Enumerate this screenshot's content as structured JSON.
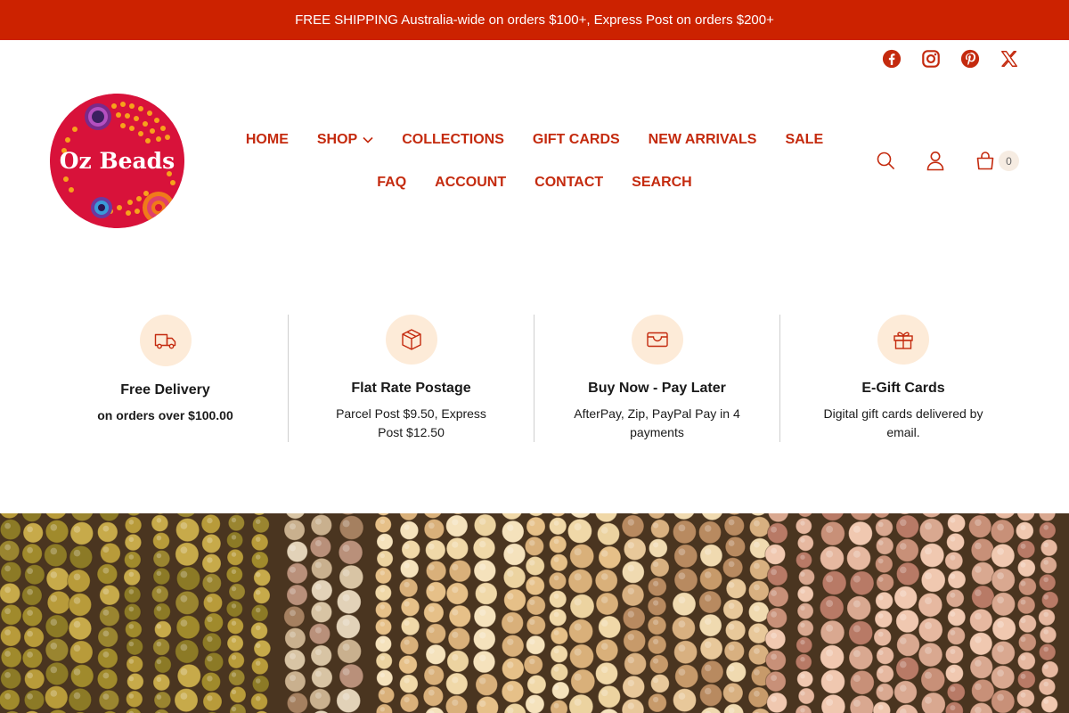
{
  "announcement": {
    "text": "FREE SHIPPING Australia-wide on orders $100+, Express Post on orders $200+"
  },
  "social": {
    "items": [
      {
        "icon": "facebook-icon"
      },
      {
        "icon": "instagram-icon"
      },
      {
        "icon": "pinterest-icon"
      },
      {
        "icon": "x-icon"
      }
    ]
  },
  "logo": {
    "text": "Oz Beads"
  },
  "nav": {
    "row1": [
      {
        "label": "HOME"
      },
      {
        "label": "SHOP"
      },
      {
        "label": "COLLECTIONS"
      },
      {
        "label": "GIFT CARDS"
      },
      {
        "label": "NEW ARRIVALS"
      },
      {
        "label": "SALE"
      }
    ],
    "row2": [
      {
        "label": "FAQ"
      },
      {
        "label": "ACCOUNT"
      },
      {
        "label": "CONTACT"
      },
      {
        "label": "SEARCH"
      }
    ]
  },
  "header_tools": {
    "cart_count": "0"
  },
  "features": [
    {
      "icon": "truck-icon",
      "title": "Free Delivery",
      "text": "on orders over $100.00"
    },
    {
      "icon": "box-icon",
      "title": "Flat Rate Postage",
      "text": "Parcel Post $9.50, Express Post $12.50"
    },
    {
      "icon": "wallet-icon",
      "title": "Buy Now - Pay Later",
      "text": "AfterPay, Zip, PayPal Pay in 4 payments"
    },
    {
      "icon": "gift-icon",
      "title": "E-Gift Cards",
      "text": "Digital gift cards delivered by email."
    }
  ],
  "colors": {
    "announcement_bg": "#cc2200",
    "nav_text": "#c42a0e",
    "logo_bg": "#d8123a",
    "feature_icon_bg": "#fdebd8"
  }
}
